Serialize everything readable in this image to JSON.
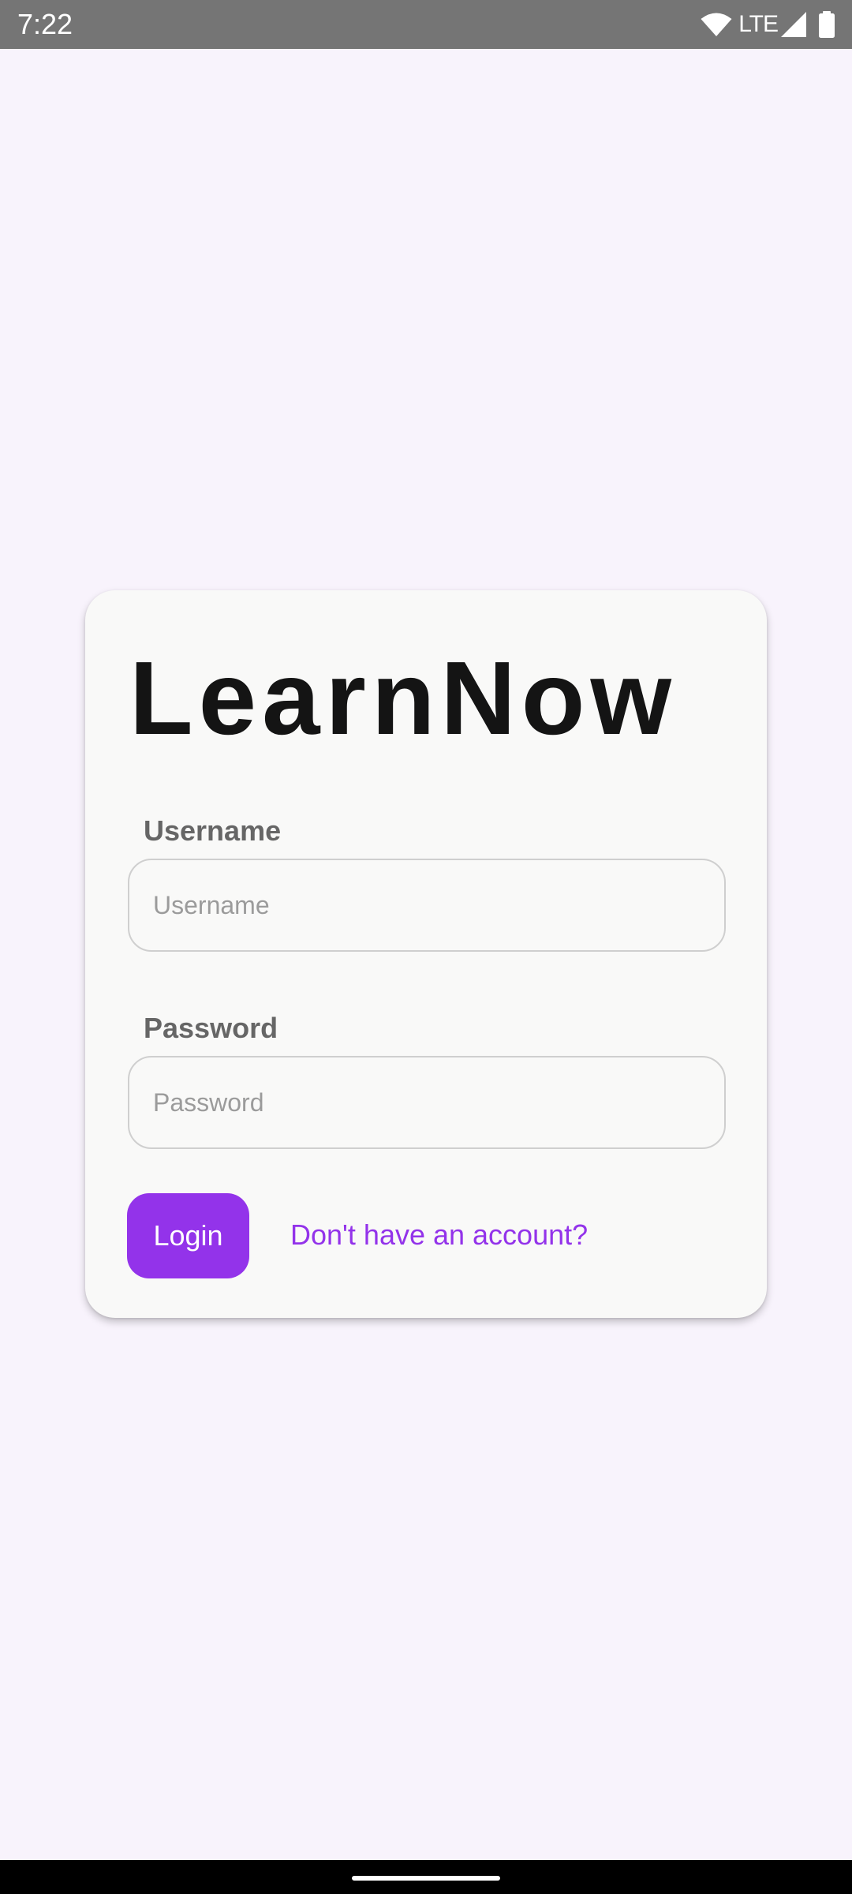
{
  "status_bar": {
    "time": "7:22",
    "network_label": "LTE",
    "icons": [
      "wifi-icon",
      "cell-signal-icon",
      "battery-icon"
    ]
  },
  "login": {
    "app_title": "LearnNow",
    "username": {
      "label": "Username",
      "placeholder": "Username",
      "value": ""
    },
    "password": {
      "label": "Password",
      "placeholder": "Password",
      "value": ""
    },
    "login_button_label": "Login",
    "signup_link_text": "Don't have an account?"
  },
  "colors": {
    "background": "#f8f3fc",
    "card": "#f9f9f8",
    "accent": "#9333ea",
    "status_bar": "#757575",
    "title_text": "#141414",
    "label_text": "#666666"
  }
}
